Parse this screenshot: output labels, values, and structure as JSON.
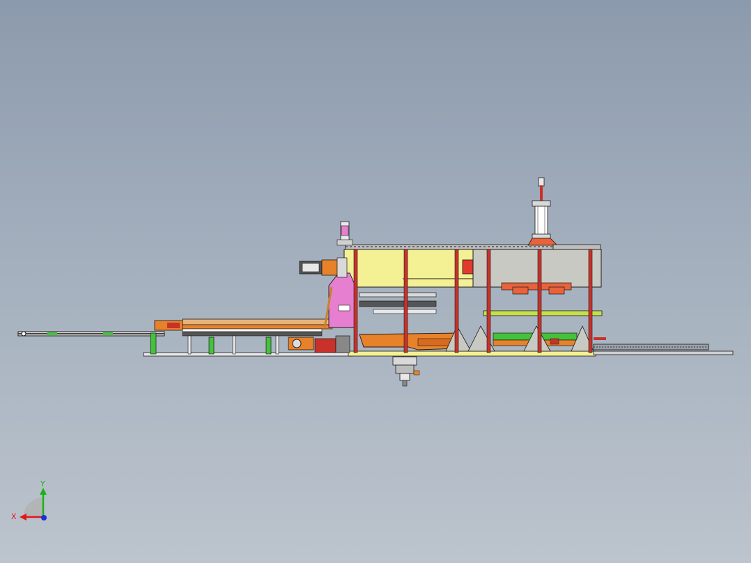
{
  "viewport": {
    "background_top": "#8c9aad",
    "background_bottom": "#bcc4cd"
  },
  "triad": {
    "x_label": "X",
    "y_label": "Y",
    "x_color": "#e01818",
    "y_color": "#18b418",
    "z_color": "#1830e0"
  },
  "palette": {
    "frame_red": "#c8322a",
    "panel_yellow": "#f4f094",
    "panel_gray": "#c9c9c4",
    "magenta": "#e77fd0",
    "orange": "#e8822a",
    "green": "#44c23a",
    "lime": "#c6e04a",
    "line": "#1a1a1a",
    "steel": "#d9d9d9"
  },
  "model": {
    "name": "",
    "view": "front"
  }
}
